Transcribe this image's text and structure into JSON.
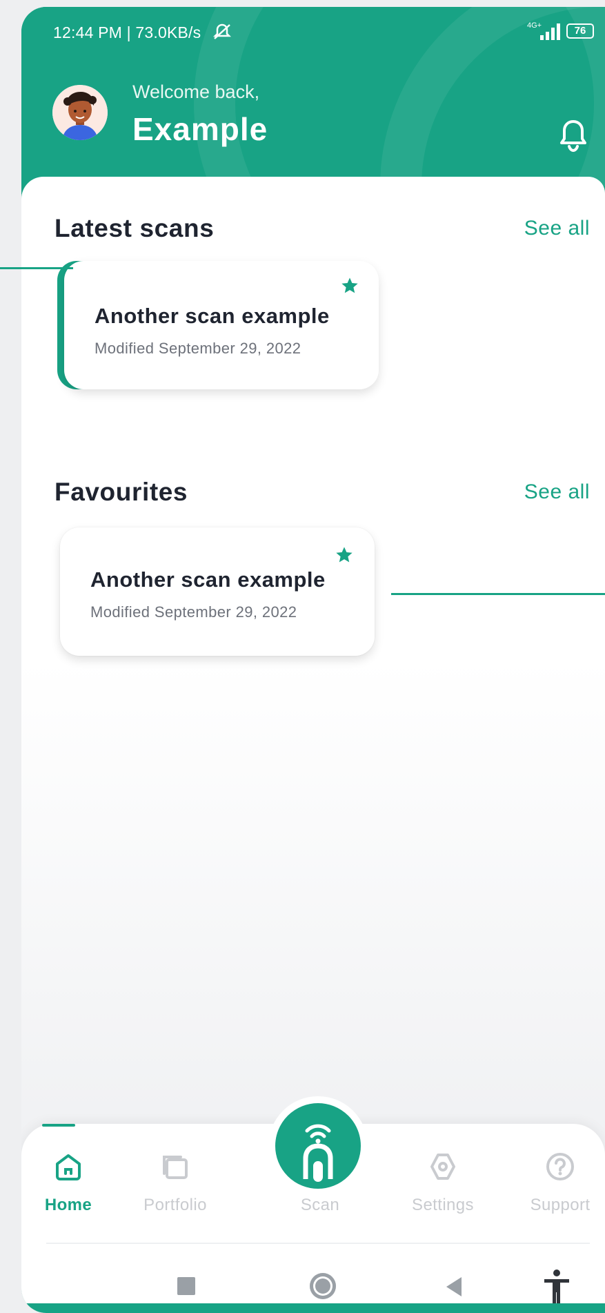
{
  "status_bar": {
    "time": "12:44 PM | 73.0KB/s",
    "network": "4G+",
    "battery": "76"
  },
  "header": {
    "welcome": "Welcome back,",
    "username": "Example"
  },
  "latest": {
    "title": "Latest scans",
    "see_all": "See all",
    "card": {
      "title": "Another scan example",
      "subtitle": "Modified September 29, 2022"
    }
  },
  "favourites": {
    "title": "Favourites",
    "see_all": "See all",
    "card": {
      "title": "Another scan example",
      "subtitle": "Modified September 29, 2022"
    }
  },
  "nav": {
    "home": "Home",
    "portfolio": "Portfolio",
    "scan": "Scan",
    "settings": "Settings",
    "support": "Support"
  },
  "colors": {
    "brand": "#18a385",
    "text": "#1f2430",
    "muted": "#6d717a"
  }
}
